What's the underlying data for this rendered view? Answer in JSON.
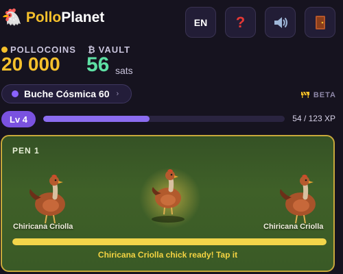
{
  "app": {
    "logo_icon": "chicken-emoji",
    "title_part1": "Pollo",
    "title_part2": "Planet"
  },
  "toolbar": {
    "lang_label": "EN",
    "help_icon": "question-mark-icon",
    "sound_icon": "speaker-icon",
    "exit_icon": "door-icon"
  },
  "stats": {
    "coins_label": "POLLOCOINS",
    "coins_value": "20 000",
    "vault_symbol": "₿",
    "vault_label": "VAULT",
    "vault_value": "56",
    "vault_unit": "sats"
  },
  "planet": {
    "name": "Buche Cósmica 60",
    "chevron": "›"
  },
  "beta": {
    "label": "BETA",
    "icon": "construction-barrier-icon"
  },
  "level": {
    "label": "Lv 4",
    "xp_text": "54 / 123 XP",
    "xp_current": 54,
    "xp_max": 123
  },
  "pen": {
    "label": "PEN 1",
    "chickens": [
      {
        "name": "Chiricana Criolla"
      },
      {
        "name": ""
      },
      {
        "name": "Chiricana Criolla"
      }
    ],
    "progress_fraction": 1.0,
    "message": "Chiricana Criolla chick ready! Tap it"
  },
  "colors": {
    "accent_gold": "#f5c02c",
    "vault_green": "#5ee0a4",
    "level_purple": "#7a52e0",
    "pen_border": "#c9a93b",
    "help_red": "#e53935"
  }
}
